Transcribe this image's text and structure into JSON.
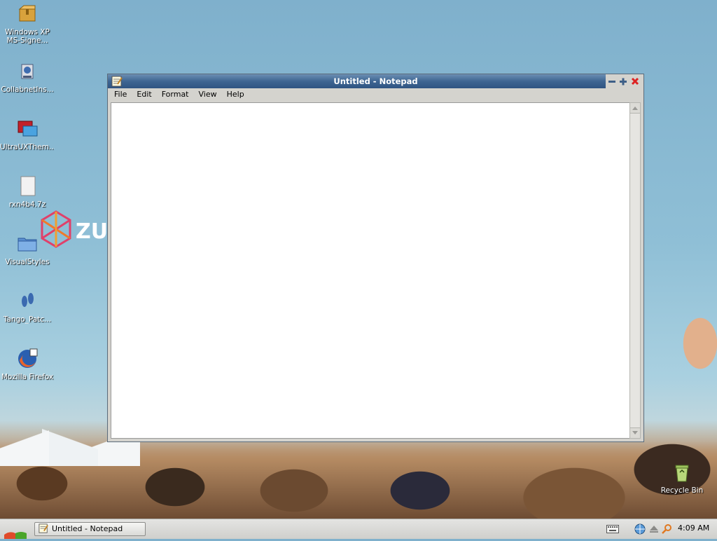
{
  "desktop": {
    "icons": [
      {
        "label": "Windows XP MS-Signe...",
        "line1": "Windows XP",
        "line2": "MS-Signe...",
        "icon": "package-icon"
      },
      {
        "label": "CollabnetIns...",
        "icon": "installer-icon"
      },
      {
        "label": "UltraUXThem...",
        "icon": "theme-icon"
      },
      {
        "label": "rxn4b4.7z",
        "icon": "file-icon"
      },
      {
        "label": "VisualStyles",
        "icon": "folder-icon"
      },
      {
        "label": "Tango_Patc...",
        "icon": "tango-icon"
      },
      {
        "label": "Mozilla Firefox",
        "icon": "firefox-icon"
      },
      {
        "label": "Recycle Bin",
        "icon": "recycle-bin-icon"
      }
    ],
    "wallpaper_logo_text": "ZU"
  },
  "notepad": {
    "title": "Untitled - Notepad",
    "menu": [
      "File",
      "Edit",
      "Format",
      "View",
      "Help"
    ],
    "content": ""
  },
  "taskbar": {
    "task_label": "Untitled - Notepad",
    "clock": "4:09 AM"
  },
  "colors": {
    "titlebar": "#3e6592",
    "close": "#dd2222",
    "taskbar": "#d8d8d5"
  }
}
